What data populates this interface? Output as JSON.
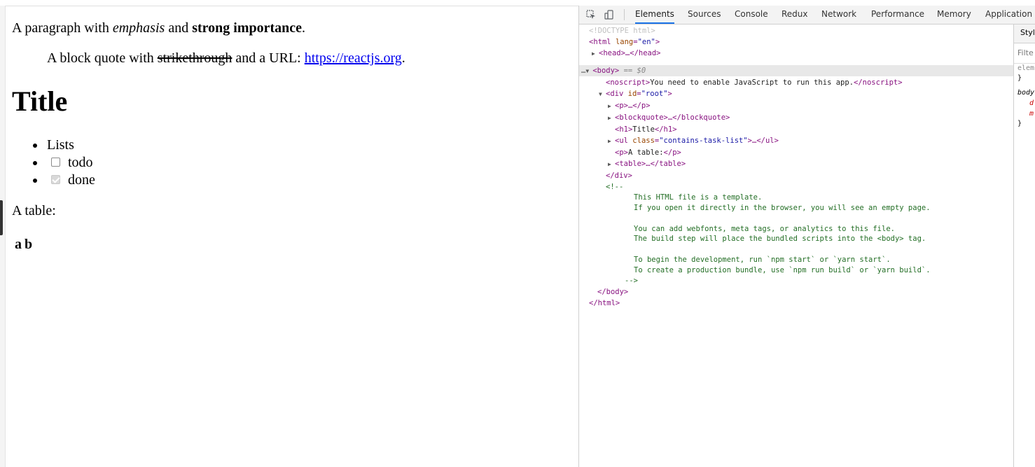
{
  "page": {
    "paragraph": {
      "prefix": "A paragraph with ",
      "em": "emphasis",
      "mid": " and ",
      "strong": "strong importance",
      "suffix": "."
    },
    "blockquote": {
      "prefix": "A block quote with ",
      "strike": "strikethrough",
      "mid": " and a URL: ",
      "link": "https://reactjs.org",
      "suffix": "."
    },
    "title": "Title",
    "list": {
      "item1": "Lists",
      "todo": "todo",
      "done": "done"
    },
    "table_label": "A table:",
    "table": {
      "headers": [
        "a",
        "b"
      ]
    }
  },
  "devtools": {
    "tabs": [
      "Elements",
      "Sources",
      "Console",
      "Redux",
      "Network",
      "Performance",
      "Memory",
      "Application"
    ],
    "active_tab": "Elements",
    "dom_lines": {
      "doctype": "<!DOCTYPE html>",
      "html_open": "<html",
      "html_attr": "lang",
      "html_val": "\"en\"",
      "head": "<head>…</head>",
      "body": "<body>",
      "body_eq": "== $0",
      "noscript_open": "<noscript>",
      "noscript_text": "You need to enable JavaScript to run this app.",
      "noscript_close": "</noscript>",
      "div_open": "<div",
      "div_attr": "id",
      "div_val": "\"root\"",
      "p": "<p>…</p>",
      "blockquote": "<blockquote>…</blockquote>",
      "h1_open": "<h1>",
      "h1_text": "Title",
      "h1_close": "</h1>",
      "ul_open": "<ul",
      "ul_attr": "class",
      "ul_val": "\"contains-task-list\"",
      "ul_close": ">…</ul>",
      "p2_open": "<p>",
      "p2_text": "A table:",
      "p2_close": "</p>",
      "table": "<table>…</table>",
      "div_close": "</div>",
      "comment_open": "<!--",
      "comment_lines": [
        "This HTML file is a template.",
        "If you open it directly in the browser, you will see an empty page.",
        "",
        "You can add webfonts, meta tags, or analytics to this file.",
        "The build step will place the bundled scripts into the <body> tag.",
        "",
        "To begin the development, run `npm start` or `yarn start`.",
        "To create a production bundle, use `npm run build` or `yarn build`."
      ],
      "comment_close": "-->",
      "body_close": "</body>",
      "html_close": "</html>"
    },
    "styles": {
      "tab": "Styl",
      "filter": "Filte",
      "rules": [
        "elem",
        "}",
        "body",
        "d",
        "m",
        "}"
      ]
    }
  }
}
